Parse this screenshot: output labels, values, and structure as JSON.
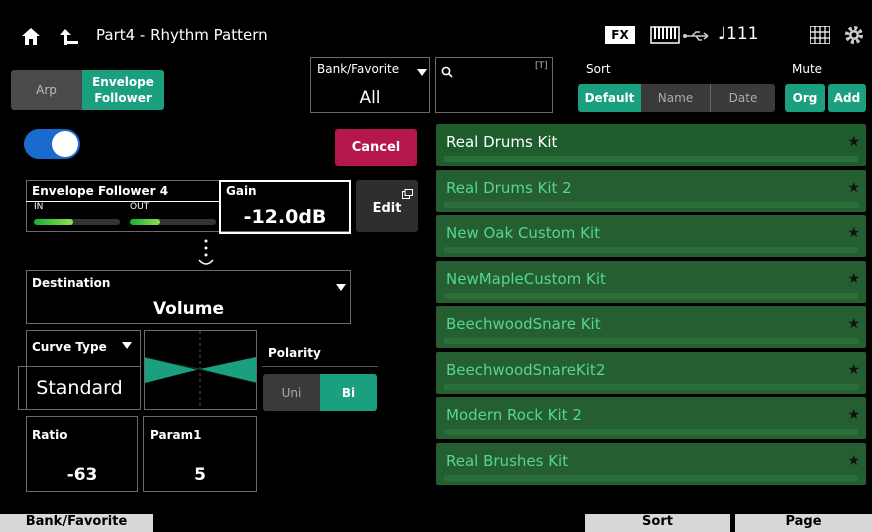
{
  "header": {
    "title": "Part4 - Rhythm Pattern",
    "fx_label": "FX",
    "tempo": "♩111"
  },
  "mode_tabs": {
    "arp": "Arp",
    "envelope_follower_line1": "Envelope",
    "envelope_follower_line2": "Follower"
  },
  "bank": {
    "label": "Bank/Favorite",
    "value": "All"
  },
  "search": {
    "value": "",
    "t_icon": "[T]"
  },
  "sort": {
    "label": "Sort",
    "options": [
      "Default",
      "Name",
      "Date"
    ],
    "selected": "Default"
  },
  "mute": {
    "label": "Mute",
    "options": [
      "Org",
      "Add"
    ]
  },
  "switch": {
    "on": true
  },
  "cancel_label": "Cancel",
  "envelope_follower": {
    "name": "Envelope Follower 4",
    "in_label": "IN",
    "out_label": "OUT",
    "in_level": 0.45,
    "out_level": 0.35
  },
  "gain": {
    "label": "Gain",
    "value": "-12.0dB"
  },
  "edit_label": "Edit",
  "destination": {
    "label": "Destination",
    "value": "Volume"
  },
  "curve": {
    "label": "Curve Type",
    "value": "Standard"
  },
  "polarity": {
    "label": "Polarity",
    "options": [
      "Uni",
      "Bi"
    ],
    "selected": "Bi"
  },
  "ratio": {
    "label": "Ratio",
    "value": "-63"
  },
  "param1": {
    "label": "Param1",
    "value": "5"
  },
  "kits": [
    {
      "name": "Real Drums Kit",
      "selected": false
    },
    {
      "name": "Real Drums Kit 2",
      "selected": true
    },
    {
      "name": "New Oak Custom Kit",
      "selected": true
    },
    {
      "name": "NewMapleCustom Kit",
      "selected": true
    },
    {
      "name": "BeechwoodSnare Kit",
      "selected": true
    },
    {
      "name": "BeechwoodSnareKit2",
      "selected": true
    },
    {
      "name": "Modern Rock Kit 2",
      "selected": true
    },
    {
      "name": "Real Brushes Kit",
      "selected": true
    }
  ],
  "bottom": {
    "bank": "Bank/Favorite",
    "sort": "Sort",
    "page": "Page"
  },
  "colors": {
    "accent": "#1aa07e",
    "cancel": "#b5174b",
    "list_bg": "#1f5c2c",
    "toggle": "#1a6ad0"
  }
}
